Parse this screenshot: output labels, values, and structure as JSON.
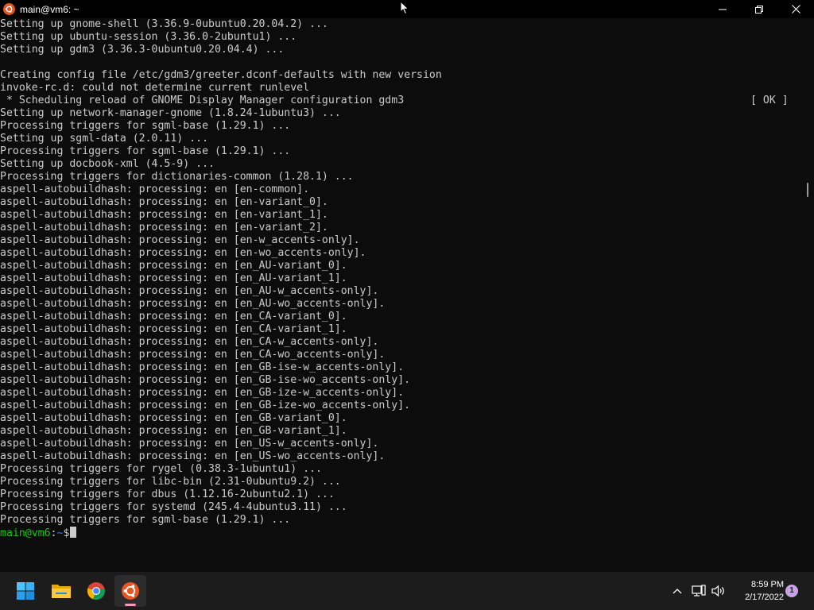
{
  "window": {
    "title": "main@vm6: ~"
  },
  "terminal": {
    "lines": [
      "Setting up gnome-shell (3.36.9-0ubuntu0.20.04.2) ...",
      "Setting up ubuntu-session (3.36.0-2ubuntu1) ...",
      "Setting up gdm3 (3.36.3-0ubuntu0.20.04.4) ...",
      "",
      "Creating config file /etc/gdm3/greeter.dconf-defaults with new version",
      "invoke-rc.d: could not determine current runlevel",
      " * Scheduling reload of GNOME Display Manager configuration gdm3",
      "Setting up network-manager-gnome (1.8.24-1ubuntu3) ...",
      "Processing triggers for sgml-base (1.29.1) ...",
      "Setting up sgml-data (2.0.11) ...",
      "Processing triggers for sgml-base (1.29.1) ...",
      "Setting up docbook-xml (4.5-9) ...",
      "Processing triggers for dictionaries-common (1.28.1) ...",
      "aspell-autobuildhash: processing: en [en-common].",
      "aspell-autobuildhash: processing: en [en-variant_0].",
      "aspell-autobuildhash: processing: en [en-variant_1].",
      "aspell-autobuildhash: processing: en [en-variant_2].",
      "aspell-autobuildhash: processing: en [en-w_accents-only].",
      "aspell-autobuildhash: processing: en [en-wo_accents-only].",
      "aspell-autobuildhash: processing: en [en_AU-variant_0].",
      "aspell-autobuildhash: processing: en [en_AU-variant_1].",
      "aspell-autobuildhash: processing: en [en_AU-w_accents-only].",
      "aspell-autobuildhash: processing: en [en_AU-wo_accents-only].",
      "aspell-autobuildhash: processing: en [en_CA-variant_0].",
      "aspell-autobuildhash: processing: en [en_CA-variant_1].",
      "aspell-autobuildhash: processing: en [en_CA-w_accents-only].",
      "aspell-autobuildhash: processing: en [en_CA-wo_accents-only].",
      "aspell-autobuildhash: processing: en [en_GB-ise-w_accents-only].",
      "aspell-autobuildhash: processing: en [en_GB-ise-wo_accents-only].",
      "aspell-autobuildhash: processing: en [en_GB-ize-w_accents-only].",
      "aspell-autobuildhash: processing: en [en_GB-ize-wo_accents-only].",
      "aspell-autobuildhash: processing: en [en_GB-variant_0].",
      "aspell-autobuildhash: processing: en [en_GB-variant_1].",
      "aspell-autobuildhash: processing: en [en_US-w_accents-only].",
      "aspell-autobuildhash: processing: en [en_US-wo_accents-only].",
      "Processing triggers for rygel (0.38.3-1ubuntu1) ...",
      "Processing triggers for libc-bin (2.31-0ubuntu9.2) ...",
      "Processing triggers for dbus (1.12.16-2ubuntu2.1) ...",
      "Processing triggers for systemd (245.4-4ubuntu3.11) ...",
      "Processing triggers for sgml-base (1.29.1) ..."
    ],
    "ok_status": "[ OK ]",
    "prompt": {
      "user_host": "main@vm6",
      "separator": ":",
      "path": "~",
      "symbol": "$"
    }
  },
  "taskbar": {
    "apps": [
      "start-icon",
      "file-explorer-icon",
      "chrome-icon",
      "ubuntu-icon"
    ],
    "clock_time": "8:59 PM",
    "clock_date": "2/17/2022",
    "notification_count": "1"
  },
  "colors": {
    "terminal_bg": "#0c0c0c",
    "terminal_fg": "#cccccc",
    "prompt_user": "#16c60c",
    "prompt_path": "#3b78ff",
    "ubuntu_orange": "#e95420",
    "taskbar_bg": "#1c1c1c"
  }
}
